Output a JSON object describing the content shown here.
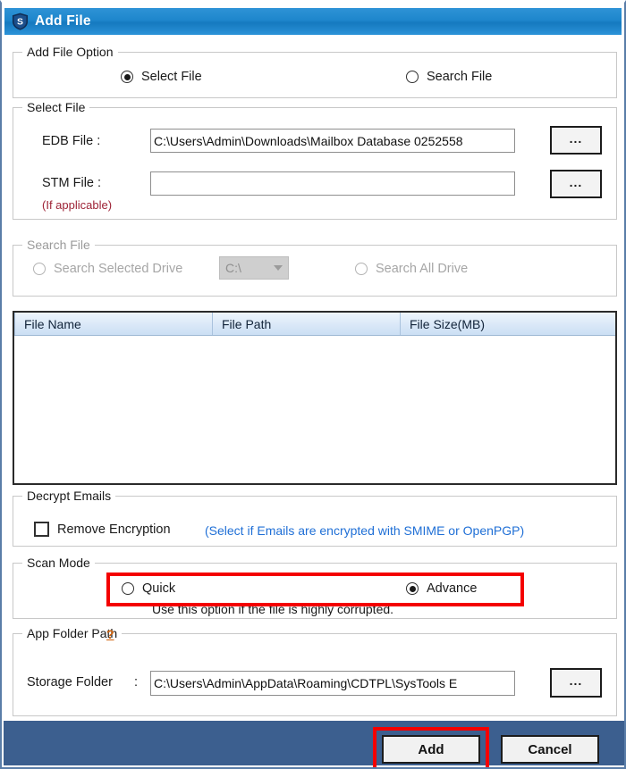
{
  "window": {
    "title": "Add File",
    "icon": "shield-s-icon"
  },
  "add_file_option": {
    "legend": "Add File Option",
    "options": [
      {
        "label": "Select File",
        "selected": true
      },
      {
        "label": "Search File",
        "selected": false
      }
    ]
  },
  "select_file": {
    "legend": "Select File",
    "edb": {
      "label": "EDB File :",
      "value": "C:\\Users\\Admin\\Downloads\\Mailbox Database 0252558",
      "browse_label": "..."
    },
    "stm": {
      "label": "STM File :",
      "value": "",
      "hint": "(If applicable)",
      "browse_label": "..."
    }
  },
  "search_file": {
    "legend": "Search File",
    "disabled": true,
    "selected_drive_label": "Search Selected Drive",
    "drive_value": "C:\\",
    "all_drive_label": "Search All Drive"
  },
  "file_list": {
    "columns": [
      "File Name",
      "File Path",
      "File Size(MB)"
    ],
    "rows": []
  },
  "decrypt_emails": {
    "legend": "Decrypt Emails",
    "checkbox_label": "Remove Encryption",
    "checked": false,
    "note": "(Select if Emails are encrypted with SMIME or OpenPGP)"
  },
  "scan_mode": {
    "legend": "Scan Mode",
    "options": [
      {
        "label": "Quick",
        "selected": false
      },
      {
        "label": "Advance",
        "selected": true
      }
    ],
    "note": "Use this option if the file is highly corrupted."
  },
  "app_folder_path": {
    "legend": "App Folder Path",
    "help_label": "?",
    "storage_label": "Storage Folder",
    "separator": ":",
    "value": "C:\\Users\\Admin\\AppData\\Roaming\\CDTPL\\SysTools E",
    "browse_label": "..."
  },
  "footer": {
    "add_label": "Add",
    "cancel_label": "Cancel"
  },
  "colors": {
    "titlebar_blue": "#1e86cc",
    "footer_blue": "#3c5f8f",
    "annotation_red": "#f40000",
    "hint_red": "#9d2235",
    "note_blue": "#1f6fd6",
    "help_orange": "#d1610a"
  }
}
